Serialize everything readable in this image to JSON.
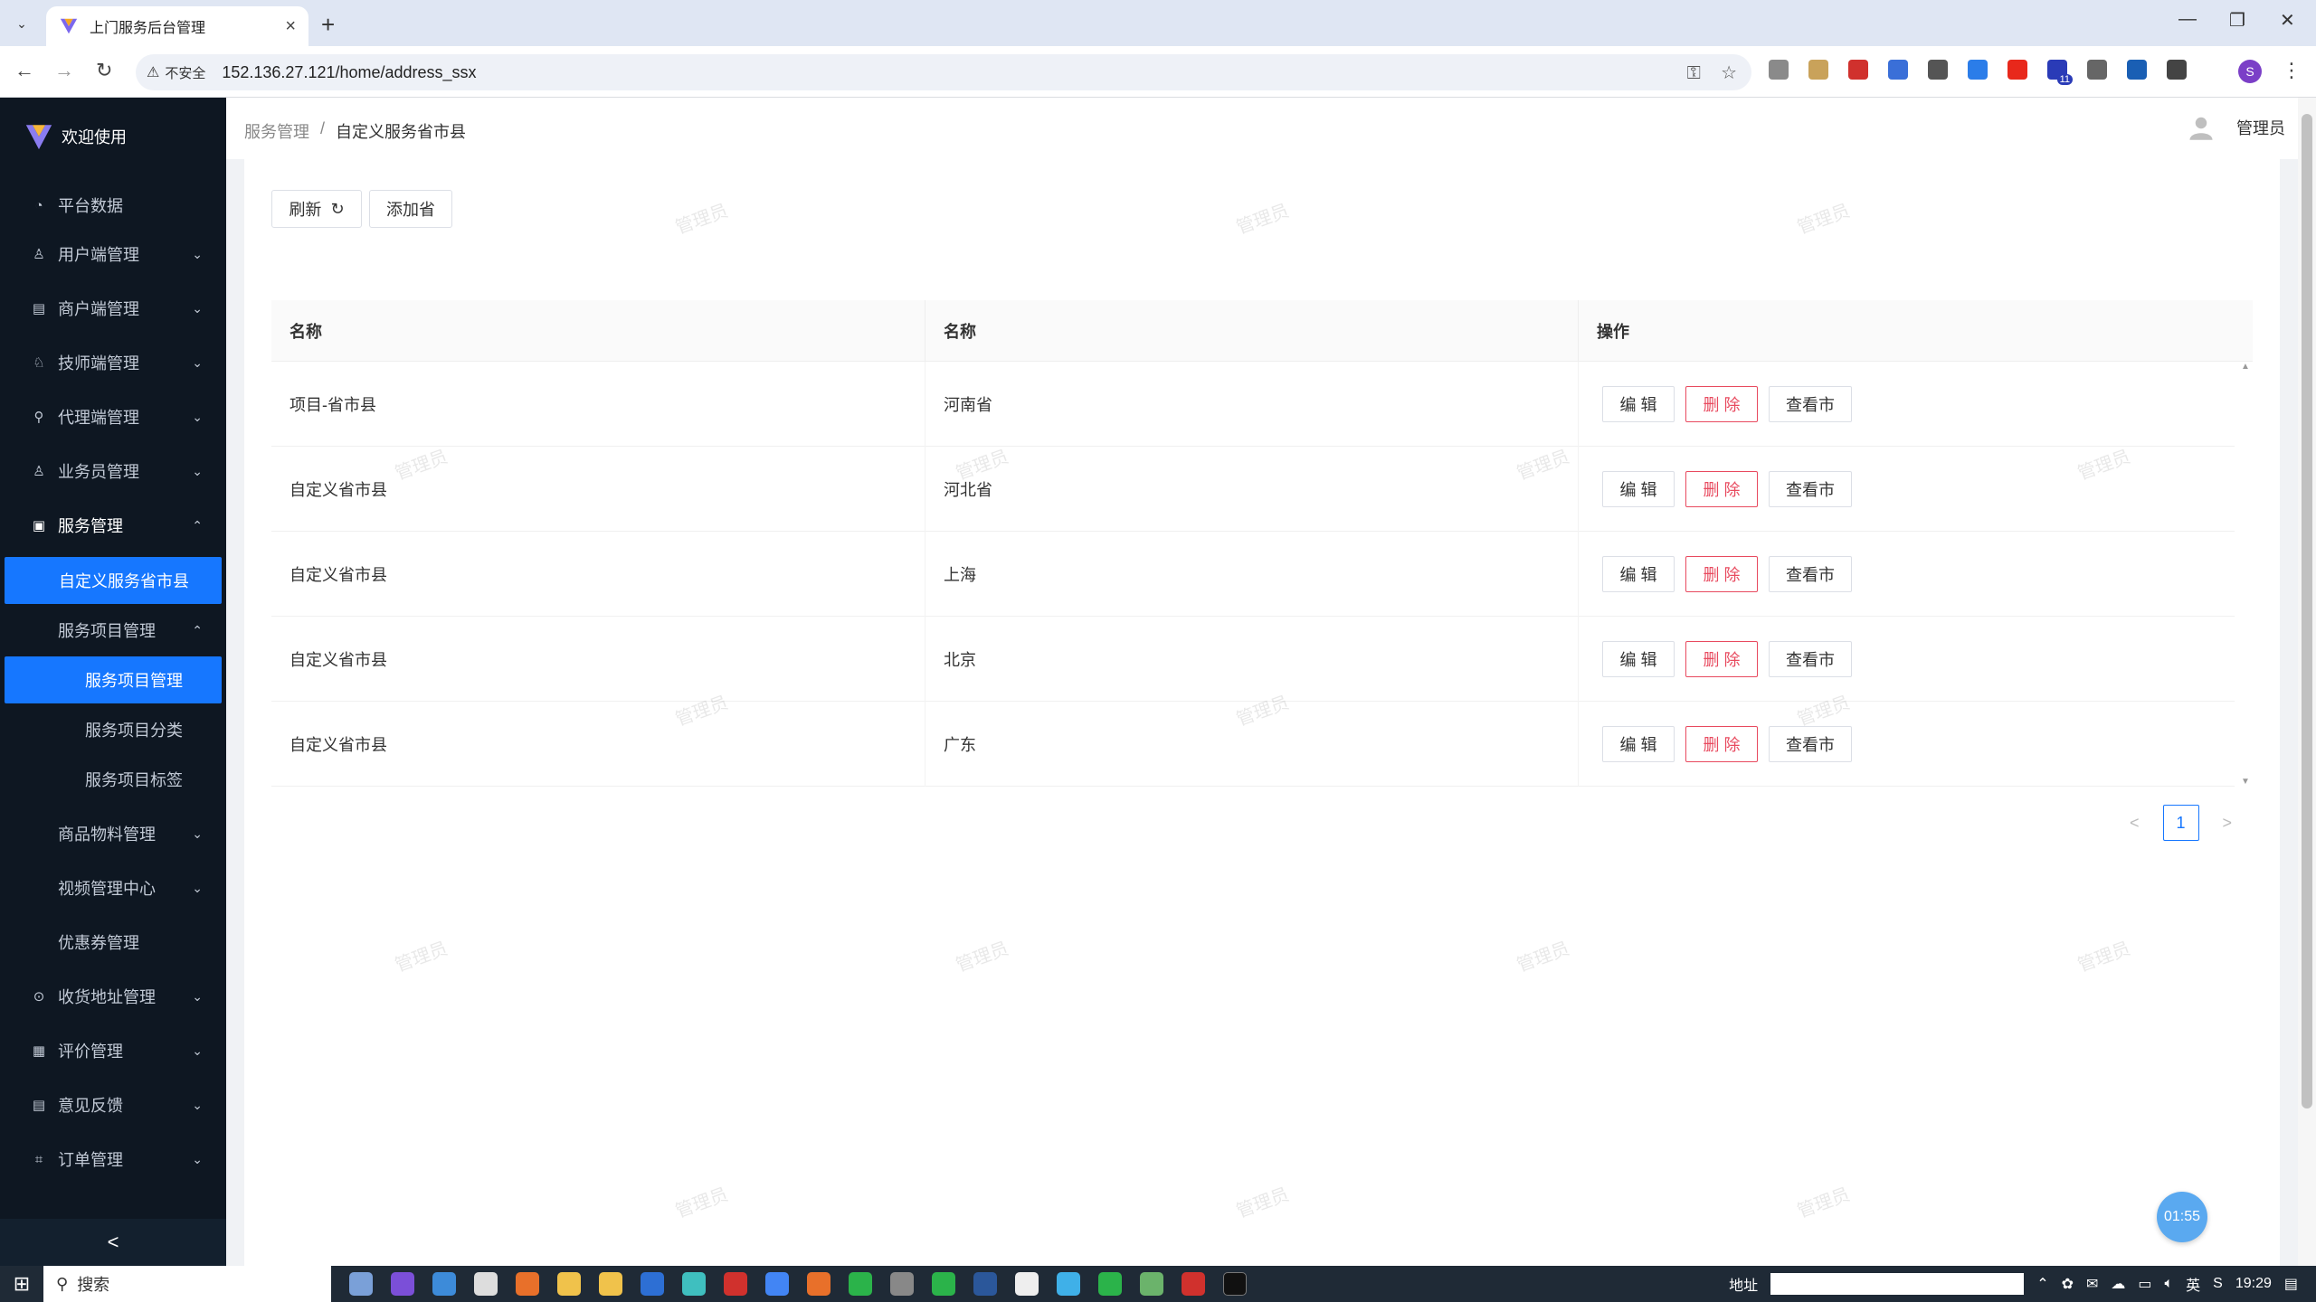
{
  "browser": {
    "tab_title": "上门服务后台管理",
    "new_tab": "+",
    "insecure_label": "不安全",
    "url": "152.136.27.121/home/address_ssx",
    "profile_initial": "S",
    "ext_badge": "11"
  },
  "app": {
    "logo_text": "欢迎使用"
  },
  "sidebar": {
    "items": [
      {
        "label": "平台数据",
        "icon": "dashboard-icon"
      },
      {
        "label": "用户端管理",
        "icon": "user-icon"
      },
      {
        "label": "商户端管理",
        "icon": "store-icon"
      },
      {
        "label": "技师端管理",
        "icon": "worker-icon"
      },
      {
        "label": "代理端管理",
        "icon": "agent-icon"
      },
      {
        "label": "业务员管理",
        "icon": "user-icon"
      },
      {
        "label": "服务管理",
        "icon": "service-icon"
      },
      {
        "label": "自定义服务省市县"
      },
      {
        "label": "服务项目管理"
      },
      {
        "label": "服务项目管理"
      },
      {
        "label": "服务项目分类"
      },
      {
        "label": "服务项目标签"
      },
      {
        "label": "商品物料管理"
      },
      {
        "label": "视频管理中心"
      },
      {
        "label": "优惠券管理"
      },
      {
        "label": "收货地址管理",
        "icon": "location-icon"
      },
      {
        "label": "评价管理",
        "icon": "review-icon"
      },
      {
        "label": "意见反馈",
        "icon": "feedback-icon"
      },
      {
        "label": "订单管理",
        "icon": "order-icon"
      }
    ],
    "collapse_glyph": "<"
  },
  "header": {
    "breadcrumb_parent": "服务管理",
    "breadcrumb_sep": "/",
    "breadcrumb_current": "自定义服务省市县",
    "user_name": "管理员"
  },
  "toolbar": {
    "refresh_label": "刷新",
    "add_label": "添加省"
  },
  "table": {
    "columns": [
      "名称",
      "名称",
      "操作"
    ],
    "rows": [
      {
        "c1": "项目-省市县",
        "c2": "河南省"
      },
      {
        "c1": "自定义省市县",
        "c2": "河北省"
      },
      {
        "c1": "自定义省市县",
        "c2": "上海"
      },
      {
        "c1": "自定义省市县",
        "c2": "北京"
      },
      {
        "c1": "自定义省市县",
        "c2": "广东"
      }
    ],
    "actions": {
      "edit": "编 辑",
      "delete": "删 除",
      "view": "查看市"
    }
  },
  "pagination": {
    "current": "1"
  },
  "watermark_text": "管理员",
  "timer": "01:55",
  "taskbar": {
    "search_label": "搜索",
    "address_label": "地址",
    "ime": "英",
    "clock": "19:29"
  },
  "colors": {
    "sidebar_bg": "#0e1722",
    "accent": "#1677ff",
    "danger": "#e84a5f"
  }
}
